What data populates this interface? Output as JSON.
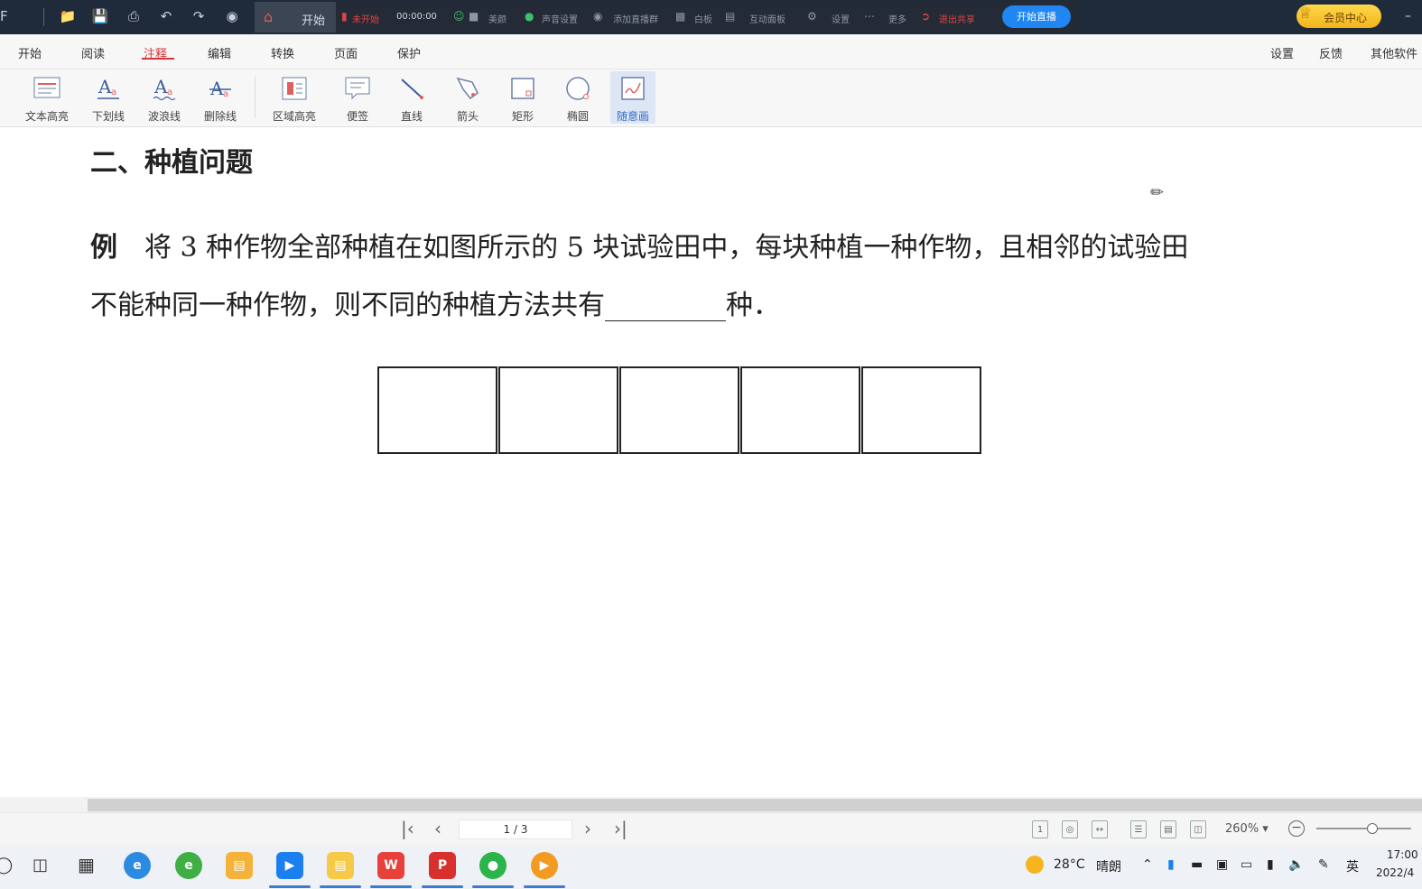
{
  "topbar": {
    "home_tab_label": "开始",
    "live_status": "未开始",
    "live_timer": "00:00:00",
    "beauty": "美颜",
    "audio": "声音设置",
    "add_group": "添加直播群",
    "whiteboard": "白板",
    "interactive": "互动面板",
    "settings": "设置",
    "more": "更多",
    "exit_share": "退出共享",
    "start_live": "开始直播",
    "vip": "会员中心"
  },
  "menubar": {
    "items": [
      "开始",
      "阅读",
      "注释",
      "编辑",
      "转换",
      "页面",
      "保护"
    ],
    "active": "注释",
    "right_items": [
      "设置",
      "反馈",
      "其他软件"
    ]
  },
  "ribbon": {
    "tools": [
      "文本高亮",
      "下划线",
      "波浪线",
      "删除线",
      "区域高亮",
      "便签",
      "直线",
      "箭头",
      "矩形",
      "椭圆",
      "随意画"
    ],
    "selected": "随意画"
  },
  "document": {
    "heading": "二、种植问题",
    "example_label": "例",
    "line1": "将 3 种作物全部种植在如图所示的 5 块试验田中，每块种植一种作物，且相邻的试验田",
    "line2_a": "不能种同一种作物，则不同的种植方法共有",
    "line2_b": "种．",
    "field_count": 5
  },
  "statusbar": {
    "page": "1 / 3",
    "zoom": "260%"
  },
  "taskbar": {
    "weather_temp": "28°C",
    "weather_desc": "晴朗",
    "ime": "英",
    "time": "17:00",
    "date": "2022/4"
  }
}
